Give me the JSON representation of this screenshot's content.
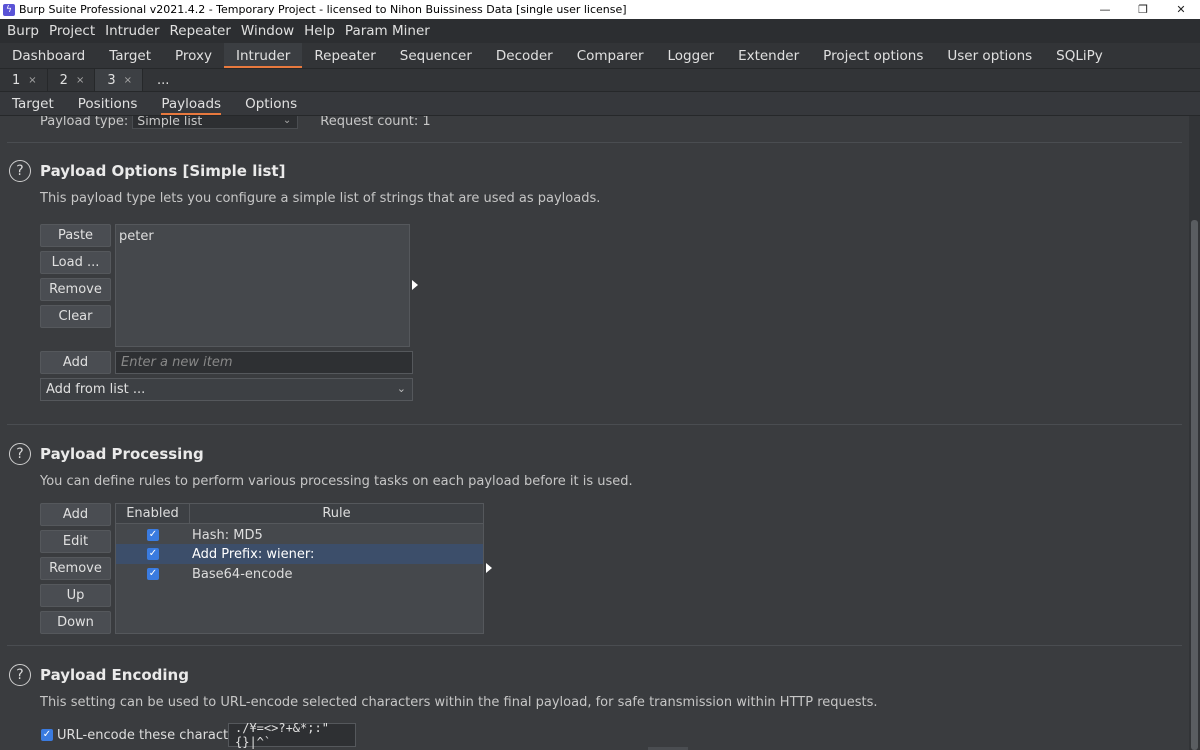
{
  "window": {
    "title": "Burp Suite Professional v2021.4.2 - Temporary Project - licensed to Nihon Buissiness Data [single user license]",
    "minimize": "—",
    "restore": "❐",
    "close": "✕"
  },
  "menubar": [
    "Burp",
    "Project",
    "Intruder",
    "Repeater",
    "Window",
    "Help",
    "Param Miner"
  ],
  "main_tabs": [
    "Dashboard",
    "Target",
    "Proxy",
    "Intruder",
    "Repeater",
    "Sequencer",
    "Decoder",
    "Comparer",
    "Logger",
    "Extender",
    "Project options",
    "User options",
    "SQLiPy"
  ],
  "main_tab_active": "Intruder",
  "attack_tabs": [
    {
      "label": "1",
      "close": "×"
    },
    {
      "label": "2",
      "close": "×"
    },
    {
      "label": "3",
      "close": "×"
    }
  ],
  "attack_tabs_more": "...",
  "section_tabs": [
    "Target",
    "Positions",
    "Payloads",
    "Options"
  ],
  "section_tab_active": "Payloads",
  "payload_sets": {
    "type_label": "Payload type:",
    "type_value": "Simple list",
    "request_count": "Request count: 1"
  },
  "payload_options": {
    "help": "?",
    "title": "Payload Options [Simple list]",
    "description": "This payload type lets you configure a simple list of strings that are used as payloads.",
    "buttons": {
      "paste": "Paste",
      "load": "Load ...",
      "remove": "Remove",
      "clear": "Clear",
      "add": "Add"
    },
    "items": [
      "peter"
    ],
    "add_placeholder": "Enter a new item",
    "add_from_list": "Add from list ..."
  },
  "payload_processing": {
    "help": "?",
    "title": "Payload Processing",
    "description": "You can define rules to perform various processing tasks on each payload before it is used.",
    "buttons": {
      "add": "Add",
      "edit": "Edit",
      "remove": "Remove",
      "up": "Up",
      "down": "Down"
    },
    "columns": {
      "enabled": "Enabled",
      "rule": "Rule"
    },
    "rules": [
      {
        "enabled": true,
        "rule": "Hash: MD5",
        "selected": false
      },
      {
        "enabled": true,
        "rule": "Add Prefix: wiener:",
        "selected": true
      },
      {
        "enabled": true,
        "rule": "Base64-encode",
        "selected": false
      }
    ]
  },
  "payload_encoding": {
    "help": "?",
    "title": "Payload Encoding",
    "description": "This setting can be used to URL-encode selected characters within the final payload, for safe transmission within HTTP requests.",
    "url_encode_label": "URL-encode these characters:",
    "url_encode_checked": true,
    "characters": "./¥=<>?+&*;:\"{}|^`"
  },
  "colors": {
    "accent_underline": "#e8793e",
    "checkbox": "#3a7be0",
    "selected_row": "#3c4e6a"
  }
}
